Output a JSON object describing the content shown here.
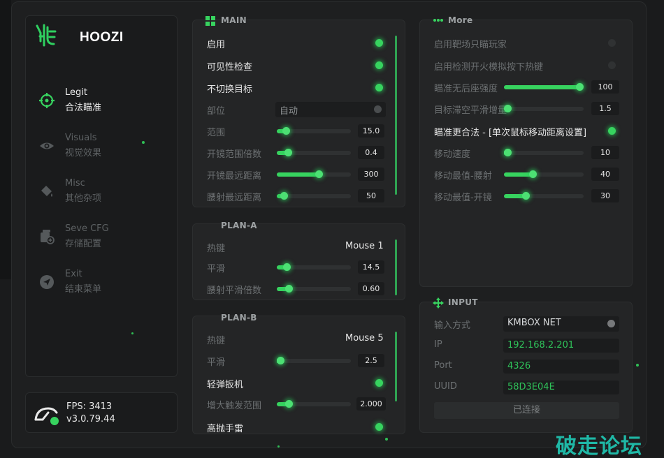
{
  "app": {
    "brand": "HOOZI"
  },
  "sidebar": {
    "items": [
      {
        "en": "Legit",
        "cn": "合法瞄准",
        "icon": "crosshair-icon",
        "active": true
      },
      {
        "en": "Visuals",
        "cn": "视觉效果",
        "icon": "eye-icon",
        "active": false
      },
      {
        "en": "Misc",
        "cn": "其他杂项",
        "icon": "paint-bucket-icon",
        "active": false
      },
      {
        "en": "Seve CFG",
        "cn": "存储配置",
        "icon": "save-config-icon",
        "active": false
      },
      {
        "en": "Exit",
        "cn": "结束菜单",
        "icon": "send-icon",
        "active": false
      }
    ]
  },
  "status": {
    "fps": "FPS: 3413",
    "version": "v3.0.79.44"
  },
  "main": {
    "title": "MAIN",
    "enable": {
      "label": "启用",
      "on": true
    },
    "visibility": {
      "label": "可见性检查",
      "on": true
    },
    "no_switch": {
      "label": "不切换目标",
      "on": true
    },
    "bone": {
      "label": "部位",
      "value": "自动"
    },
    "range": {
      "label": "范围",
      "value": "15.0",
      "fraction": 0.12
    },
    "scope_range": {
      "label": "开镜范围倍数",
      "value": "0.4",
      "fraction": 0.15
    },
    "scope_dist": {
      "label": "开镜最远距离",
      "value": "300",
      "fraction": 0.57
    },
    "hip_dist": {
      "label": "腰射最远距离",
      "value": "50",
      "fraction": 0.09
    }
  },
  "plan_a": {
    "title": "PLAN-A",
    "hotkey": {
      "label": "热键",
      "value": "Mouse 1"
    },
    "smooth": {
      "label": "平滑",
      "value": "14.5",
      "fraction": 0.13
    },
    "hip_smooth": {
      "label": "腰射平滑倍数",
      "value": "0.60",
      "fraction": 0.16
    }
  },
  "plan_b": {
    "title": "PLAN-B",
    "hotkey": {
      "label": "热键",
      "value": "Mouse 5"
    },
    "smooth": {
      "label": "平滑",
      "value": "2.5",
      "fraction": 0.02
    },
    "trigger": {
      "label": "轻弹扳机",
      "on": true
    },
    "trigger_range": {
      "label": "增大触发范围",
      "value": "2.000",
      "fraction": 0.16
    },
    "grenade": {
      "label": "高抛手雷",
      "on": true
    }
  },
  "more": {
    "title": "More",
    "range_only": {
      "label": "启用靶场只瞄玩家",
      "on": false
    },
    "fire_detect": {
      "label": "启用检测开火模拟按下热键",
      "on": false
    },
    "no_recoil": {
      "label": "瞄准无后座强度",
      "value": "100",
      "fraction": 0.95
    },
    "air_smooth": {
      "label": "目标滞空平滑增量",
      "value": "1.5",
      "fraction": 0.04
    },
    "legit_aim": {
      "label": "瞄准更合法 - [单次鼠标移动距离设置]",
      "on": true
    },
    "move_speed": {
      "label": "移动速度",
      "value": "10",
      "fraction": 0.03
    },
    "move_max_hip": {
      "label": "移动最值-腰射",
      "value": "40",
      "fraction": 0.36
    },
    "move_max_scope": {
      "label": "移动最值-开镜",
      "value": "30",
      "fraction": 0.27
    }
  },
  "input": {
    "title": "INPUT",
    "method": {
      "label": "输入方式",
      "value": "KMBOX NET"
    },
    "ip": {
      "label": "IP",
      "value": "192.168.2.201"
    },
    "port": {
      "label": "Port",
      "value": "4326"
    },
    "uuid": {
      "label": "UUID",
      "value": "58D3E04E"
    },
    "connect_label": "已连接"
  },
  "watermark": "破走论坛",
  "colors": {
    "accent": "#37d35f",
    "panel": "#242526",
    "background": "#1e1f20"
  }
}
